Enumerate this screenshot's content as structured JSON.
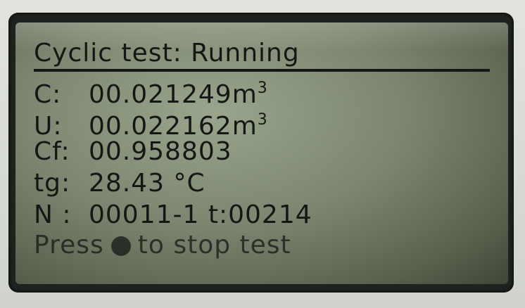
{
  "screen": {
    "title": "Cyclic test: Running",
    "rows": [
      {
        "label": "C:",
        "value": "00.021249",
        "unit": "m",
        "unit_sup": "3"
      },
      {
        "label": "U:",
        "value": "00.022162",
        "unit": "m",
        "unit_sup": "3"
      },
      {
        "label": "Cf:",
        "value": "00.958803",
        "unit": "",
        "unit_sup": ""
      },
      {
        "label": "tg:",
        "value": "28.43 °C",
        "unit": "",
        "unit_sup": ""
      }
    ],
    "counter_label": "N :",
    "counter_value": "00011-1",
    "time_label": "t:",
    "time_value": "00214",
    "footer_pre": "Press",
    "footer_post": "to stop test"
  }
}
